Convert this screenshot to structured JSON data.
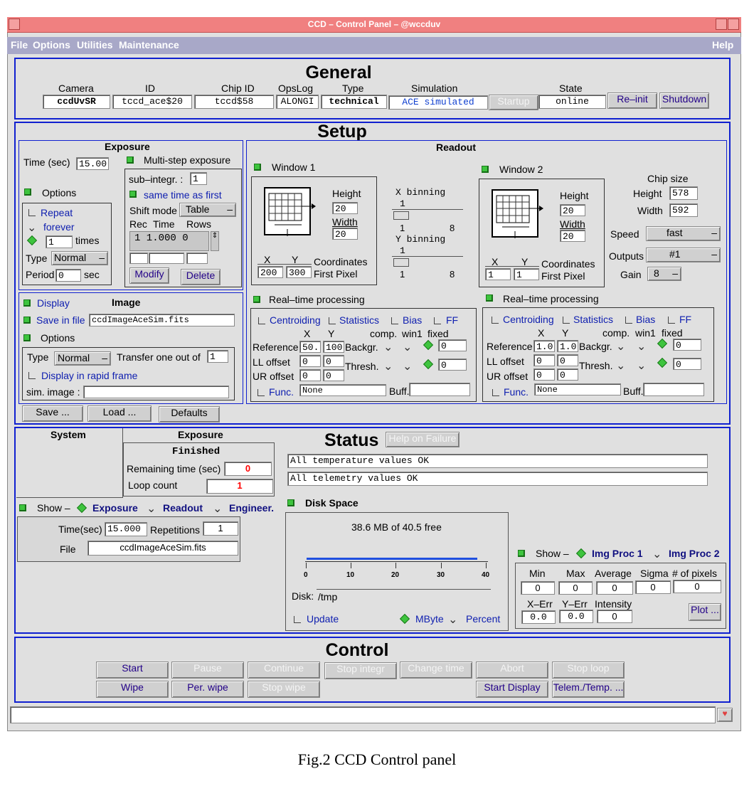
{
  "window": {
    "title": "CCD – Control Panel – @wccduv"
  },
  "menu": {
    "file": "File",
    "options": "Options",
    "utilities": "Utilities",
    "maintenance": "Maintenance",
    "help": "Help"
  },
  "general": {
    "title": "General",
    "headers": {
      "camera": "Camera",
      "id": "ID",
      "chip_id": "Chip ID",
      "opslog": "OpsLog",
      "type": "Type",
      "simulation": "Simulation",
      "state": "State"
    },
    "values": {
      "camera": "ccdUvSR",
      "id": "tccd_ace$20",
      "chip_id": "tccd$58",
      "opslog": "ALONGI",
      "type": "technical",
      "simulation": "ACE simulated",
      "state": "online"
    },
    "buttons": {
      "startup": "Startup",
      "reinit": "Re–init",
      "shutdown": "Shutdown"
    }
  },
  "setup": {
    "title": "Setup",
    "exposure": {
      "title": "Exposure",
      "time_label": "Time (sec)",
      "time_value": "15.00",
      "multi_step": "Multi-step exposure",
      "options_label": "Options",
      "repeat": "Repeat",
      "forever": "forever",
      "times_value": "1",
      "times_label": "times",
      "type_label": "Type",
      "type_value": "Normal",
      "period_label": "Period",
      "period_value": "0",
      "sec": "sec",
      "subintegr_label": "sub–integr. :",
      "subintegr_value": "1",
      "same_time": "same time as first",
      "shift_mode_label": "Shift mode",
      "shift_mode_value": "Table",
      "table_headers": [
        "Rec",
        "Time",
        "Rows"
      ],
      "table_row": "1 1.000 0",
      "modify": "Modify",
      "delete": "Delete"
    },
    "image": {
      "display": "Display",
      "title": "Image",
      "save_in_file": "Save in file",
      "file_value": "ccdImageAceSim.fits",
      "options_label": "Options",
      "type_label": "Type",
      "type_value": "Normal",
      "transfer_label": "Transfer one out of",
      "transfer_value": "1",
      "rapid_frame": "Display in rapid frame",
      "sim_image_label": "sim. image :"
    },
    "buttons": {
      "save": "Save ...",
      "load": "Load ...",
      "defaults": "Defaults"
    },
    "readout": {
      "title": "Readout",
      "window1": {
        "label": "Window 1",
        "height_label": "Height",
        "height_value": "20",
        "width_label": "Width",
        "width_value": "20",
        "x_label": "X",
        "y_label": "Y",
        "x_value": "200",
        "y_value": "300",
        "coords_label": "Coordinates",
        "first_pixel": "First Pixel"
      },
      "window2": {
        "label": "Window 2",
        "height_label": "Height",
        "height_value": "20",
        "width_label": "Width",
        "width_value": "20",
        "x_label": "X",
        "y_label": "Y",
        "x_value": "1",
        "y_value": "1",
        "coords_label": "Coordinates",
        "first_pixel": "First Pixel"
      },
      "xbin": {
        "label": "X binning",
        "value": "1",
        "min": "1",
        "max": "8"
      },
      "ybin": {
        "label": "Y binning",
        "value": "1",
        "min": "1",
        "max": "8"
      },
      "chip": {
        "title": "Chip size",
        "height_label": "Height",
        "height_value": "578",
        "width_label": "Width",
        "width_value": "592"
      },
      "speed_label": "Speed",
      "speed_value": "fast",
      "outputs_label": "Outputs",
      "outputs_value": "#1",
      "gain_label": "Gain",
      "gain_value": "8"
    },
    "rtp1": {
      "label": "Real–time processing",
      "centroiding": "Centroiding",
      "statistics": "Statistics",
      "bias": "Bias",
      "ff": "FF",
      "x": "X",
      "y": "Y",
      "comp": "comp.",
      "win1": "win1",
      "fixed": "fixed",
      "reference": "Reference",
      "ref_x": "50.",
      "ref_y": "100",
      "backgr": "Backgr.",
      "backgr_val": "0",
      "ll": "LL offset",
      "ll_x": "0",
      "ll_y": "0",
      "thresh": "Thresh.",
      "thresh_val": "0",
      "ur": "UR offset",
      "ur_x": "0",
      "ur_y": "0",
      "func": "Func.",
      "func_value": "None",
      "buff": "Buff."
    },
    "rtp2": {
      "label": "Real–time processing",
      "centroiding": "Centroiding",
      "statistics": "Statistics",
      "bias": "Bias",
      "ff": "FF",
      "x": "X",
      "y": "Y",
      "comp": "comp.",
      "win1": "win1",
      "fixed": "fixed",
      "reference": "Reference",
      "ref_x": "1.0",
      "ref_y": "1.0",
      "backgr": "Backgr.",
      "backgr_val": "0",
      "ll": "LL offset",
      "ll_x": "0",
      "ll_y": "0",
      "thresh": "Thresh.",
      "thresh_val": "0",
      "ur": "UR offset",
      "ur_x": "0",
      "ur_y": "0",
      "func": "Func.",
      "func_value": "None",
      "buff": "Buff."
    }
  },
  "status": {
    "title": "Status",
    "help_failure": "Help on Failure",
    "system_label": "System",
    "exposure_label": "Exposure",
    "finished": "Finished",
    "remaining_label": "Remaining time (sec)",
    "remaining_value": "0",
    "loop_label": "Loop count",
    "loop_value": "1",
    "messages": [
      "All temperature values OK",
      "All telemetry values OK"
    ],
    "show_label": "Show –",
    "show_exposure": "Exposure",
    "show_readout": "Readout",
    "show_engineer": "Engineer.",
    "timesec_label": "Time(sec)",
    "timesec_value": "15.000",
    "repetitions_label": "Repetitions",
    "repetitions_value": "1",
    "file_label": "File",
    "file_value": "ccdImageAceSim.fits",
    "disk": {
      "label": "Disk Space",
      "summary": "38.6 MB of 40.5 free",
      "fill_fraction": 0.953,
      "ticks": [
        "0",
        "10",
        "20",
        "30",
        "40"
      ],
      "disk_label": "Disk:",
      "disk_value": "/tmp",
      "update": "Update",
      "mbyte": "MByte",
      "percent": "Percent"
    },
    "img": {
      "show_label": "Show –",
      "proc1": "Img Proc 1",
      "proc2": "Img Proc 2",
      "headers": [
        "Min",
        "Max",
        "Average",
        "Sigma",
        "# of pixels"
      ],
      "values": [
        "0",
        "0",
        "0",
        "0",
        "0"
      ],
      "xerr_label": "X–Err",
      "yerr_label": "Y–Err",
      "intensity_label": "Intensity",
      "xerr": "0.0",
      "yerr": "0.0",
      "intensity": "0",
      "plot": "Plot ..."
    }
  },
  "control": {
    "title": "Control",
    "row1": [
      "Start",
      "Pause",
      "Continue",
      "Stop integr",
      "Change time",
      "Abort",
      "Stop loop"
    ],
    "row2": [
      "Wipe",
      "Per. wipe",
      "Stop wipe",
      "Start Display",
      "Telem./Temp. ..."
    ]
  },
  "caption": "Fig.2 CCD Control panel"
}
